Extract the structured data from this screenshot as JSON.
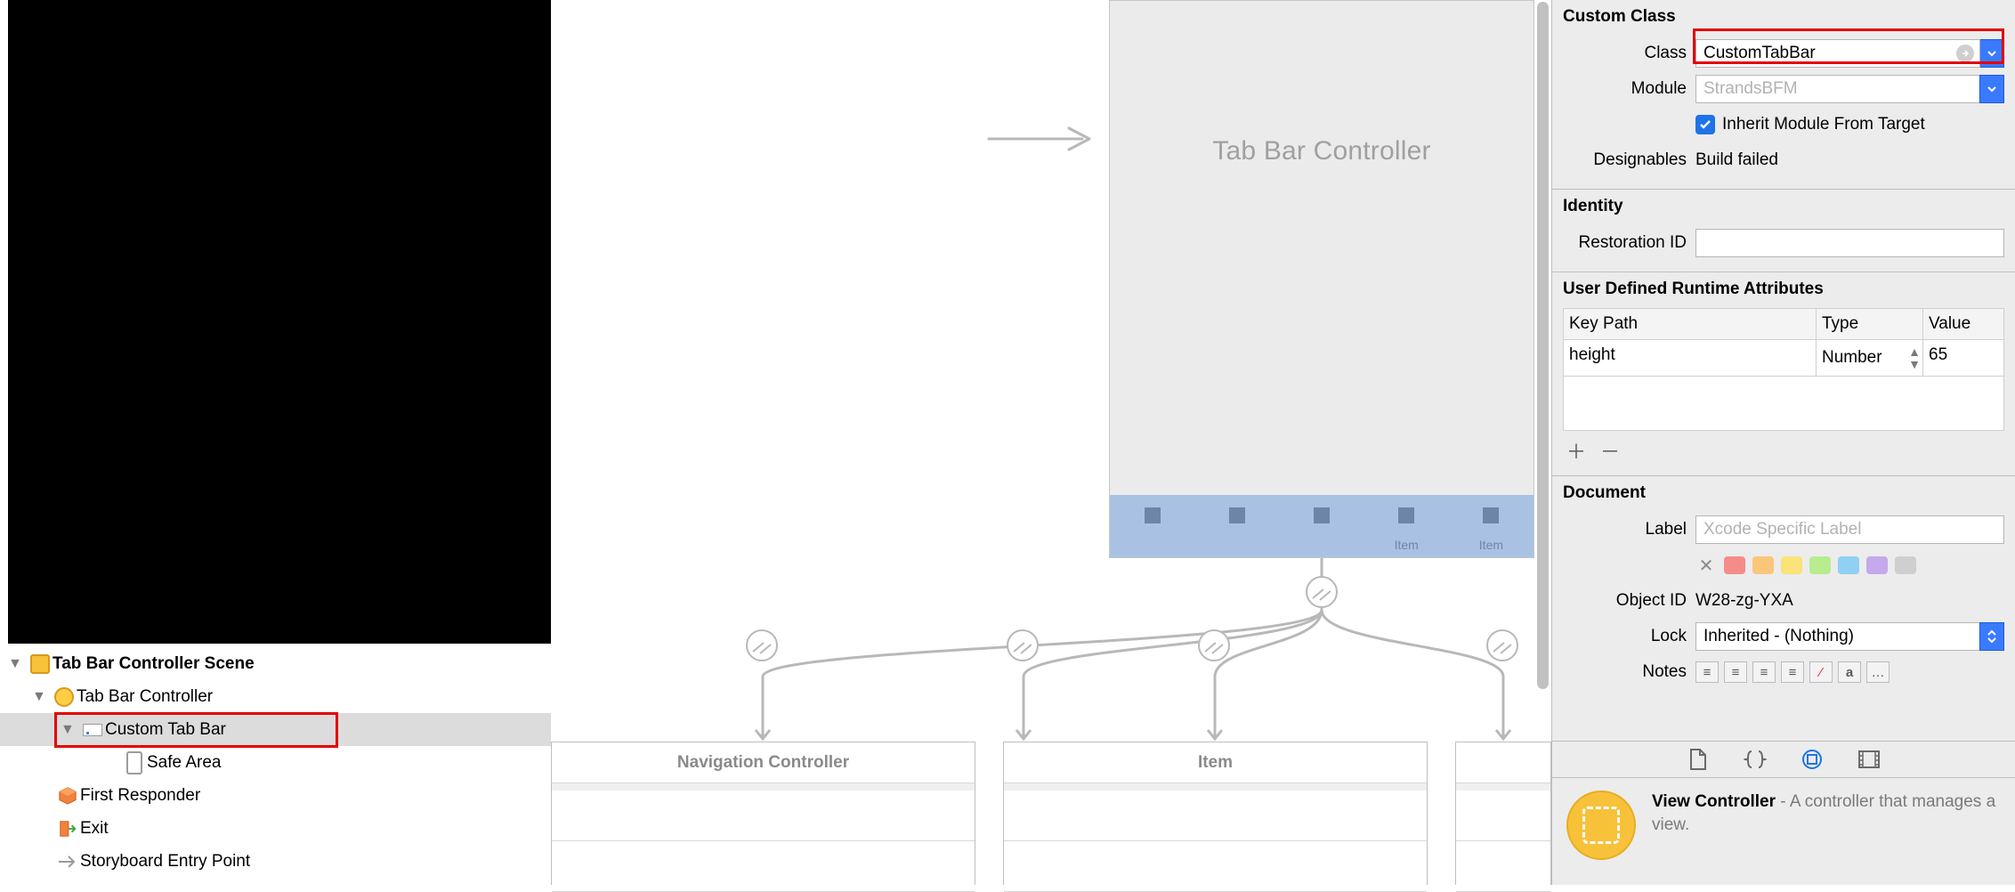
{
  "tree": {
    "scene": "Tab Bar Controller Scene",
    "controller": "Tab Bar Controller",
    "custom": "Custom Tab Bar",
    "safearea": "Safe Area",
    "firstresp": "First Responder",
    "exit": "Exit",
    "entrypoint": "Storyboard Entry Point"
  },
  "canvas": {
    "tbc_label": "Tab Bar Controller",
    "tab_item_label": "Item",
    "card1_title": "Navigation Controller",
    "card2_title": "Item"
  },
  "inspector": {
    "custom_class": {
      "section": "Custom Class",
      "class_label": "Class",
      "class_value": "CustomTabBar",
      "module_label": "Module",
      "module_placeholder": "StrandsBFM",
      "inherit_label": "Inherit Module From Target",
      "designables_label": "Designables",
      "designables_value": "Build failed"
    },
    "identity": {
      "section": "Identity",
      "restoration_label": "Restoration ID"
    },
    "udra": {
      "section": "User Defined Runtime Attributes",
      "col_key": "Key Path",
      "col_type": "Type",
      "col_value": "Value",
      "row1_key": "height",
      "row1_type": "Number",
      "row1_value": "65"
    },
    "document": {
      "section": "Document",
      "label_label": "Label",
      "label_placeholder": "Xcode Specific Label",
      "objectid_label": "Object ID",
      "objectid_value": "W28-zg-YXA",
      "lock_label": "Lock",
      "lock_value": "Inherited - (Nothing)",
      "notes_label": "Notes",
      "colors": [
        "#f58c87",
        "#fac67a",
        "#f9e37a",
        "#b8ec8f",
        "#8fd0f4",
        "#c6a8ec",
        "#cfcfcf"
      ]
    },
    "library": {
      "title": "View Controller",
      "desc": " - A controller that manages a view."
    }
  }
}
